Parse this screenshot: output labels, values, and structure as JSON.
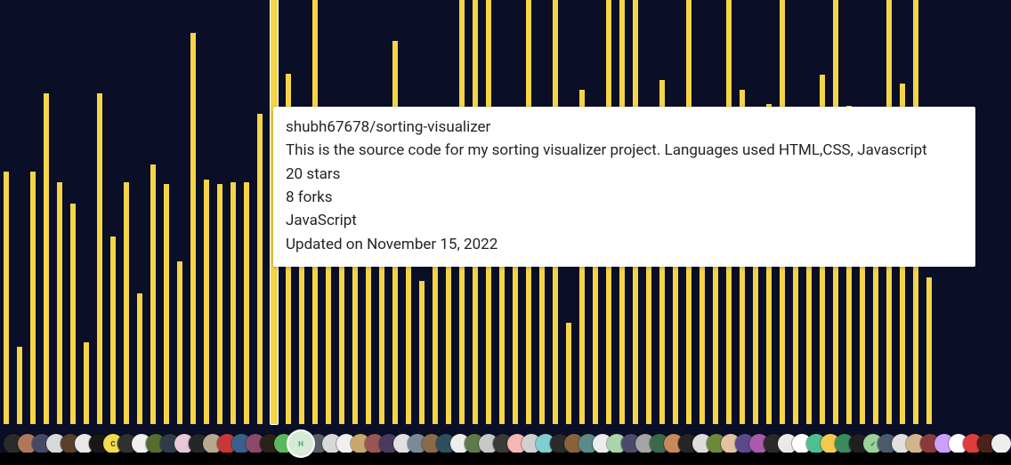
{
  "chart_data": {
    "type": "bar",
    "title": "",
    "xlabel": "",
    "ylabel": "",
    "ylim": [
      0,
      520
    ],
    "active_index": 20,
    "values": [
      310,
      95,
      310,
      405,
      296,
      270,
      100,
      405,
      230,
      296,
      160,
      318,
      294,
      200,
      480,
      300,
      294,
      296,
      297,
      380,
      520,
      430,
      255,
      520,
      255,
      290,
      366,
      290,
      312,
      470,
      300,
      176,
      295,
      215,
      520,
      520,
      520,
      295,
      300,
      520,
      296,
      520,
      124,
      410,
      290,
      520,
      520,
      520,
      296,
      422,
      296,
      520,
      240,
      355,
      520,
      410,
      380,
      392,
      520,
      244,
      314,
      428,
      520,
      390,
      290,
      296,
      520,
      418,
      520,
      180
    ]
  },
  "tooltip": {
    "title": "shubh67678/sorting-visualizer",
    "description": "This is the source code for my sorting visualizer project. Languages used HTML,CSS, Javascript",
    "stars": "20 stars",
    "forks": "8 forks",
    "language": "JavaScript",
    "updated": "Updated on November 15, 2022"
  },
  "avatars": {
    "active_index": 20,
    "items": [
      {
        "bg": "#2b2b2b",
        "fg": "#888",
        "txt": ""
      },
      {
        "bg": "#b0785a",
        "fg": "#fff",
        "txt": ""
      },
      {
        "bg": "#444a66",
        "fg": "#fff",
        "txt": ""
      },
      {
        "bg": "#d9d9d9",
        "fg": "#555",
        "txt": ""
      },
      {
        "bg": "#5a3f2b",
        "fg": "#fff",
        "txt": ""
      },
      {
        "bg": "#e8e8e8",
        "fg": "#333",
        "txt": ""
      },
      {
        "bg": "#181818",
        "fg": "#ccc",
        "txt": ""
      },
      {
        "bg": "#f2dc4e",
        "fg": "#333",
        "txt": "C"
      },
      {
        "bg": "#303030",
        "fg": "#bbb",
        "txt": ""
      },
      {
        "bg": "#f0f0f0",
        "fg": "#333",
        "txt": ""
      },
      {
        "bg": "#556b2f",
        "fg": "#fff",
        "txt": ""
      },
      {
        "bg": "#2f3a4a",
        "fg": "#fff",
        "txt": ""
      },
      {
        "bg": "#e8c8d8",
        "fg": "#333",
        "txt": ""
      },
      {
        "bg": "#262626",
        "fg": "#ccc",
        "txt": ""
      },
      {
        "bg": "#b8a890",
        "fg": "#fff",
        "txt": ""
      },
      {
        "bg": "#c83737",
        "fg": "#fff",
        "txt": ""
      },
      {
        "bg": "#3a5f8a",
        "fg": "#fff",
        "txt": ""
      },
      {
        "bg": "#8a4a6a",
        "fg": "#fff",
        "txt": ""
      },
      {
        "bg": "#2b2215",
        "fg": "#ccc",
        "txt": ""
      },
      {
        "bg": "#5cb85c",
        "fg": "#fff",
        "txt": ""
      },
      {
        "bg": "#d6ead6",
        "fg": "#3a6",
        "txt": "H"
      },
      {
        "bg": "#555f6a",
        "fg": "#fff",
        "txt": ""
      },
      {
        "bg": "#d8d8d8",
        "fg": "#444",
        "txt": ""
      },
      {
        "bg": "#f0f0f0",
        "fg": "#333",
        "txt": ""
      },
      {
        "bg": "#c9a66b",
        "fg": "#fff",
        "txt": ""
      },
      {
        "bg": "#955",
        "fg": "#fff",
        "txt": ""
      },
      {
        "bg": "#4a3a60",
        "fg": "#fff",
        "txt": ""
      },
      {
        "bg": "#e0e0e0",
        "fg": "#555",
        "txt": ""
      },
      {
        "bg": "#7a8a99",
        "fg": "#fff",
        "txt": ""
      },
      {
        "bg": "#8a6a4a",
        "fg": "#fff",
        "txt": ""
      },
      {
        "bg": "#2f4f5f",
        "fg": "#fff",
        "txt": ""
      },
      {
        "bg": "#eee",
        "fg": "#555",
        "txt": ""
      },
      {
        "bg": "#5f7a4a",
        "fg": "#fff",
        "txt": ""
      },
      {
        "bg": "#c8c8c8",
        "fg": "#333",
        "txt": ""
      },
      {
        "bg": "#3a3a3a",
        "fg": "#ccc",
        "txt": ""
      },
      {
        "bg": "#f5b7b1",
        "fg": "#a33",
        "txt": ""
      },
      {
        "bg": "#d0d0d0",
        "fg": "#444",
        "txt": ""
      },
      {
        "bg": "#7ecfcf",
        "fg": "#fff",
        "txt": ""
      },
      {
        "bg": "#2b2b2b",
        "fg": "#aaa",
        "txt": ""
      },
      {
        "bg": "#8a623a",
        "fg": "#fff",
        "txt": ""
      },
      {
        "bg": "#5a8a8a",
        "fg": "#fff",
        "txt": ""
      },
      {
        "bg": "#ececec",
        "fg": "#444",
        "txt": ""
      },
      {
        "bg": "#aad4aa",
        "fg": "#363",
        "txt": ""
      },
      {
        "bg": "#4a4a6a",
        "fg": "#fff",
        "txt": ""
      },
      {
        "bg": "#a5a5a5",
        "fg": "#333",
        "txt": ""
      },
      {
        "bg": "#3a6a4a",
        "fg": "#fff",
        "txt": ""
      },
      {
        "bg": "#c98a5a",
        "fg": "#fff",
        "txt": ""
      },
      {
        "bg": "#252525",
        "fg": "#bbb",
        "txt": ""
      },
      {
        "bg": "#ddd",
        "fg": "#555",
        "txt": ""
      },
      {
        "bg": "#6a8a3a",
        "fg": "#fff",
        "txt": ""
      },
      {
        "bg": "#e2c2a2",
        "fg": "#553",
        "txt": ""
      },
      {
        "bg": "#5a4a8a",
        "fg": "#fff",
        "txt": ""
      },
      {
        "bg": "#aa5aaa",
        "fg": "#fff",
        "txt": ""
      },
      {
        "bg": "#2a2a2a",
        "fg": "#aaa",
        "txt": ""
      },
      {
        "bg": "#e8e8e8",
        "fg": "#555",
        "txt": ""
      },
      {
        "bg": "#ffffff",
        "fg": "#333",
        "txt": ""
      },
      {
        "bg": "#4fc08d",
        "fg": "#fff",
        "txt": ""
      },
      {
        "bg": "#f2c94c",
        "fg": "#333",
        "txt": ""
      },
      {
        "bg": "#3a8a5a",
        "fg": "#fff",
        "txt": ""
      },
      {
        "bg": "#202020",
        "fg": "#bbb",
        "txt": ""
      },
      {
        "bg": "#9ad29a",
        "fg": "#363",
        "txt": "✓"
      },
      {
        "bg": "#4a5a6a",
        "fg": "#fff",
        "txt": ""
      },
      {
        "bg": "#e0e0e0",
        "fg": "#555",
        "txt": ""
      },
      {
        "bg": "#d2b48c",
        "fg": "#553",
        "txt": ""
      },
      {
        "bg": "#8a3a3a",
        "fg": "#fff",
        "txt": ""
      },
      {
        "bg": "#cf9fff",
        "fg": "#fff",
        "txt": ""
      },
      {
        "bg": "#ffffff",
        "fg": "#333",
        "txt": ""
      },
      {
        "bg": "#e03c3c",
        "fg": "#fff",
        "txt": ""
      },
      {
        "bg": "#4a221a",
        "fg": "#fff",
        "txt": ""
      },
      {
        "bg": "#eee",
        "fg": "#555",
        "txt": ""
      }
    ]
  }
}
